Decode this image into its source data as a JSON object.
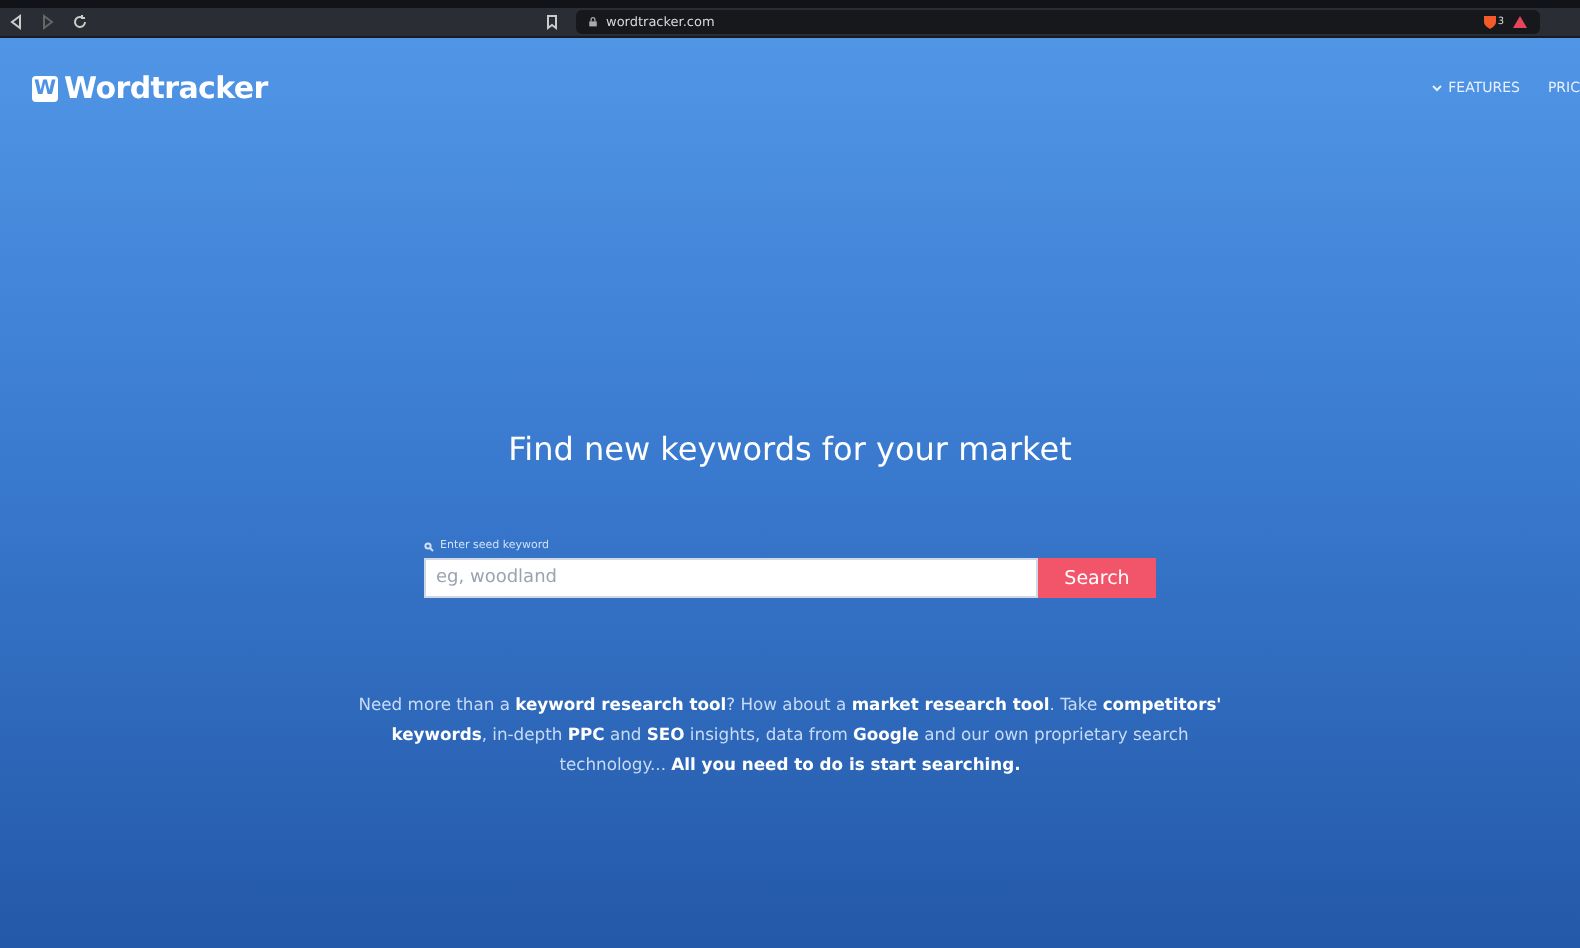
{
  "browser": {
    "address": "wordtracker.com",
    "shield_badge": "3"
  },
  "header": {
    "logo_mark": "W",
    "logo_text": "Wordtracker",
    "nav": [
      {
        "label": "FEATURES",
        "has_menu": true
      },
      {
        "label": "PRIC",
        "has_menu": false
      }
    ]
  },
  "hero": {
    "title": "Find new keywords for your market",
    "search": {
      "label": "Enter seed keyword",
      "placeholder": "eg, woodland",
      "button": "Search"
    },
    "description": "Need more than a **keyword research tool**? How about a **market research tool**. Take **competitors' keywords**, in-depth **PPC** and **SEO** insights, data from **Google** and our own proprietary search technology... **All you need to do is start searching.**"
  }
}
